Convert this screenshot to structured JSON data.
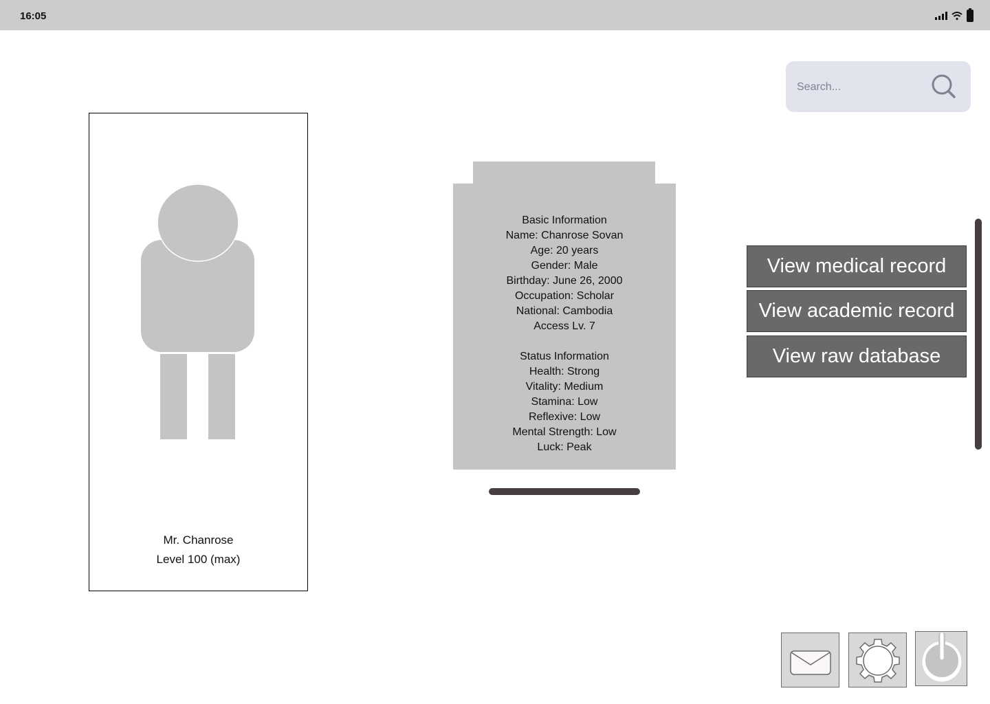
{
  "status_bar": {
    "time": "16:05",
    "icons": [
      "signal-icon",
      "wifi-icon",
      "battery-icon"
    ]
  },
  "search": {
    "placeholder": "Search...",
    "value": "",
    "icon": "search-icon"
  },
  "profile": {
    "name": "Mr. Chanrose",
    "level": "Level 100 (max)",
    "avatar_icon": "person-silhouette-icon"
  },
  "info_panel": {
    "basic_title": "Basic Information",
    "basic_lines": [
      "Name: Chanrose Sovan",
      "Age: 20 years",
      "Gender: Male",
      "Birthday: June 26, 2000",
      "Occupation: Scholar",
      "National: Cambodia",
      "Access Lv. 7"
    ],
    "status_title": "Status Information",
    "status_lines": [
      "Health: Strong",
      "Vitality: Medium",
      "Stamina: Low",
      "Reflexive: Low",
      "Mental Strength: Low",
      "Luck: Peak"
    ]
  },
  "actions": {
    "medical": "View medical record",
    "academic": "View academic record",
    "database": "View raw database"
  },
  "dock": {
    "mail_icon": "mail-icon",
    "settings_icon": "gear-icon",
    "power_icon": "power-icon"
  },
  "colors": {
    "status_bar": "#cccccc",
    "panel_gray": "#c4c4c4",
    "button_gray": "#6b6868",
    "search_bg": "#e1e4ec",
    "scrollbar": "#473f3f"
  }
}
